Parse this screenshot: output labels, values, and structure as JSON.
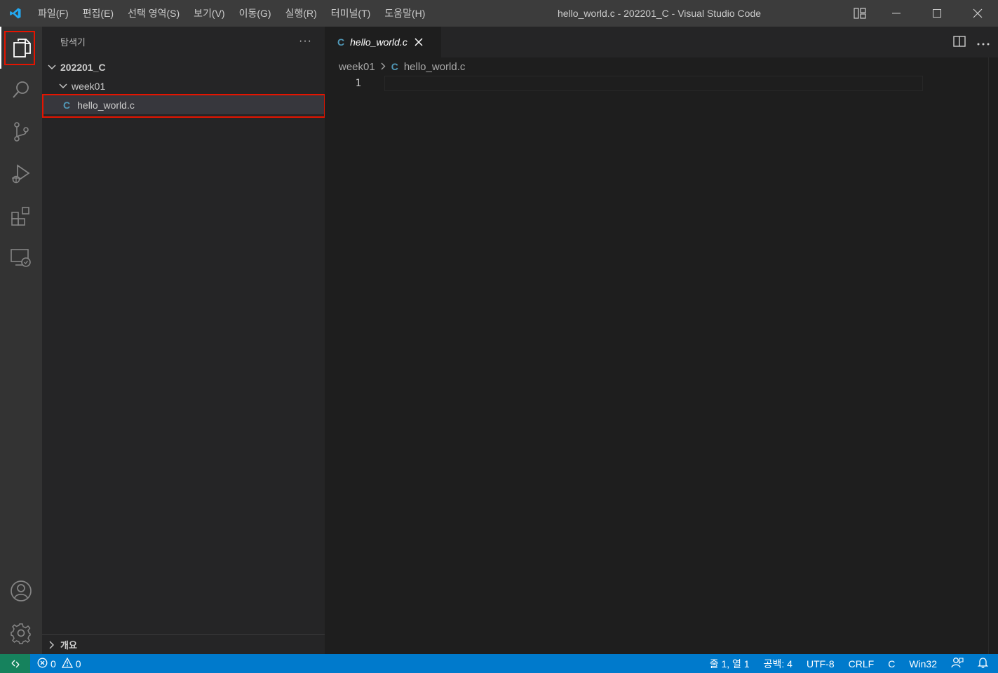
{
  "titlebar": {
    "menu": [
      "파일(F)",
      "편집(E)",
      "선택 영역(S)",
      "보기(V)",
      "이동(G)",
      "실행(R)",
      "터미널(T)",
      "도움말(H)"
    ],
    "window_title": "hello_world.c - 202201_C - Visual Studio Code"
  },
  "sidebar": {
    "title": "탐색기",
    "more": "···",
    "root_folder": "202201_C",
    "subfolder": "week01",
    "file": "hello_world.c",
    "outline": "개요"
  },
  "editor": {
    "tab_label": "hello_world.c",
    "breadcrumb": {
      "folder": "week01",
      "file": "hello_world.c"
    },
    "line_numbers": [
      "1"
    ],
    "lang_icon": "C"
  },
  "statusbar": {
    "errors": "0",
    "warnings": "0",
    "position": "줄 1, 열 1",
    "indent": "공백: 4",
    "encoding": "UTF-8",
    "eol": "CRLF",
    "language": "C",
    "platform": "Win32"
  },
  "colors": {
    "accent": "#007acc",
    "remote": "#16825d",
    "highlight": "#e51400",
    "c_icon": "#519aba"
  }
}
